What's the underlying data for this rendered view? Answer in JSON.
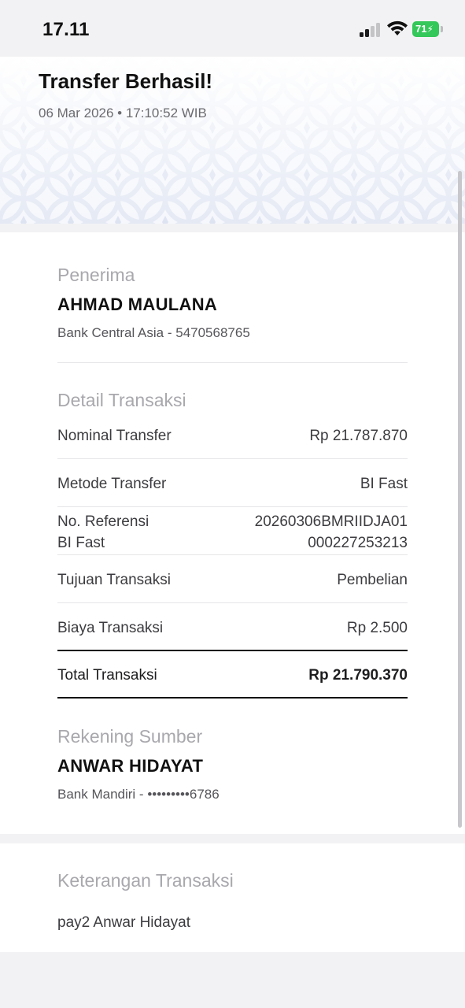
{
  "status_bar": {
    "time": "17.11",
    "battery": "71"
  },
  "header": {
    "title": "Transfer Berhasil!",
    "datetime": "06 Mar 2026 • 17:10:52 WIB"
  },
  "recipient": {
    "label": "Penerima",
    "name": "AHMAD MAULANA",
    "account": "Bank Central Asia - 5470568765"
  },
  "details": {
    "label": "Detail Transaksi",
    "rows": [
      {
        "label": "Nominal Transfer",
        "value": "Rp 21.787.870"
      },
      {
        "label": "Metode Transfer",
        "value": "BI Fast"
      },
      {
        "label_line1": "No. Referensi",
        "label_line2": "BI Fast",
        "value_line1": "20260306BMRIIDJA01",
        "value_line2": "000227253213"
      },
      {
        "label": "Tujuan Transaksi",
        "value": "Pembelian"
      },
      {
        "label": "Biaya Transaksi",
        "value": "Rp 2.500"
      }
    ],
    "total_label": "Total Transaksi",
    "total_value": "Rp 21.790.370"
  },
  "source": {
    "label": "Rekening Sumber",
    "name": "ANWAR HIDAYAT",
    "account": "Bank Mandiri - •••••••••6786"
  },
  "note": {
    "label": "Keterangan Transaksi",
    "value": "pay2 Anwar Hidayat"
  },
  "colors": {
    "background": "#f2f2f4",
    "card": "#ffffff",
    "battery": "#34c759",
    "muted_label": "#a8a8ad"
  }
}
